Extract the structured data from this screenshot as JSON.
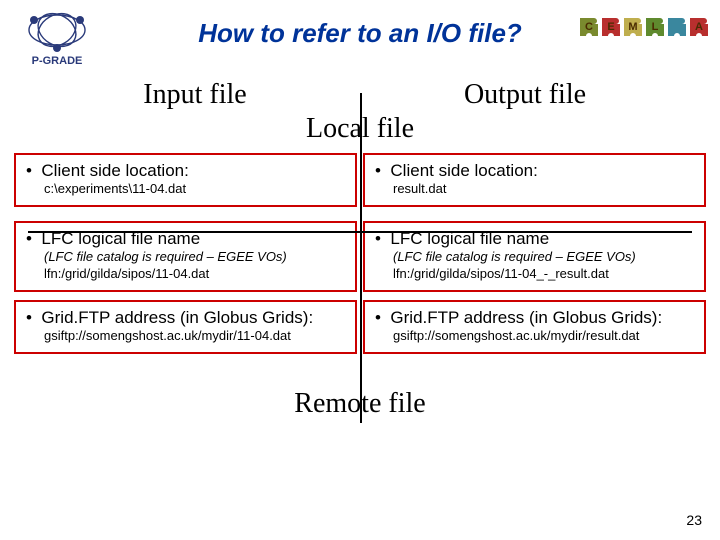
{
  "title": "How to refer to an I/O file?",
  "headers": {
    "input": "Input file",
    "output": "Output file"
  },
  "subheaders": {
    "local": "Local file",
    "remote": "Remote file"
  },
  "rows": [
    {
      "left": {
        "head": "Client side location:",
        "sub": "c:\\experiments\\11-04.dat"
      },
      "right": {
        "head": "Client side location:",
        "sub": "result.dat"
      }
    },
    {
      "left": {
        "head": "LFC logical file name",
        "sub_italic": "(LFC file catalog is required – EGEE VOs)",
        "sub2": "lfn:/grid/gilda/sipos/11-04.dat"
      },
      "right": {
        "head": "LFC logical file name",
        "sub_italic": "(LFC file catalog is required – EGEE VOs)",
        "sub2": "lfn:/grid/gilda/sipos/11-04_-_result.dat"
      }
    },
    {
      "left": {
        "head": "Grid.FTP address (in Globus Grids):",
        "sub": "gsiftp://somengshost.ac.uk/mydir/11-04.dat"
      },
      "right": {
        "head": "Grid.FTP address (in Globus Grids):",
        "sub": "gsiftp://somengshost.ac.uk/mydir/result.dat"
      }
    }
  ],
  "page_number": "23",
  "logo_left_label": "P-GRADE",
  "puzzle_letters": [
    "C",
    "E",
    "M",
    "L",
    "",
    "A"
  ],
  "puzzle_colors": [
    "#7a8a2e",
    "#b82f2e",
    "#bfae4e",
    "#5f8a2e",
    "#3a879e",
    "#b82f2e"
  ]
}
